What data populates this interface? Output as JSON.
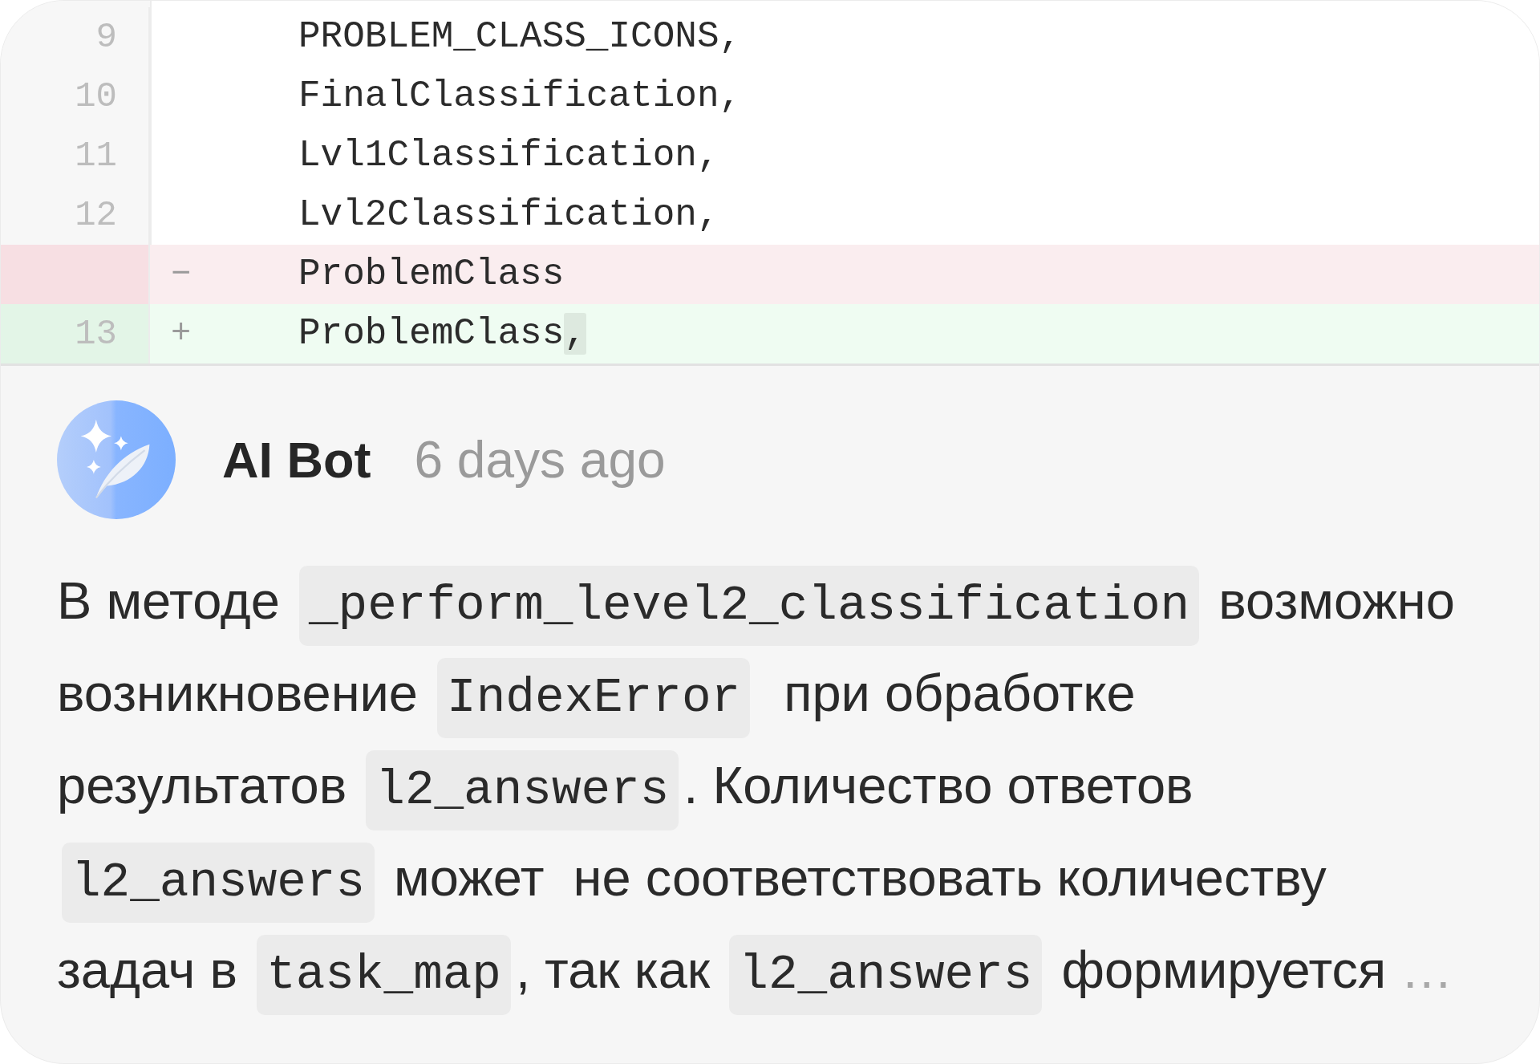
{
  "diff": {
    "lines": [
      {
        "kind": "context",
        "number": "9",
        "segments": [
          {
            "text": "PROBLEM_CLASS_ICONS,",
            "changed": false
          }
        ]
      },
      {
        "kind": "context",
        "number": "10",
        "segments": [
          {
            "text": "FinalClassification,",
            "changed": false
          }
        ]
      },
      {
        "kind": "context",
        "number": "11",
        "segments": [
          {
            "text": "Lvl1Classification,",
            "changed": false
          }
        ]
      },
      {
        "kind": "context",
        "number": "12",
        "segments": [
          {
            "text": "Lvl2Classification,",
            "changed": false
          }
        ]
      },
      {
        "kind": "deleted",
        "sign": "−",
        "segments": [
          {
            "text": "ProblemClass",
            "changed": false
          }
        ]
      },
      {
        "kind": "added",
        "number": "13",
        "sign": "+",
        "segments": [
          {
            "text": "ProblemClass",
            "changed": false
          },
          {
            "text": ",",
            "changed": true
          }
        ]
      }
    ]
  },
  "comment": {
    "author": "AI Bot",
    "time": "6 days ago",
    "body": {
      "lines": [
        [
          {
            "kind": "text",
            "text": "В методе "
          },
          {
            "kind": "code",
            "text": "_perform_level2_classification"
          },
          {
            "kind": "text",
            "text": " возможно"
          }
        ],
        [
          {
            "kind": "text",
            "text": "возникновение "
          },
          {
            "kind": "code",
            "text": "IndexError"
          },
          {
            "kind": "text",
            "text": "  при обработке"
          }
        ],
        [
          {
            "kind": "text",
            "text": "результатов "
          },
          {
            "kind": "code",
            "text": "l2_answers"
          },
          {
            "kind": "text",
            "text": ". Количество ответов"
          }
        ],
        [
          {
            "kind": "code",
            "text": "l2_answers"
          },
          {
            "kind": "text",
            "text": " может  не соответствовать количеству"
          }
        ],
        [
          {
            "kind": "text",
            "text": "задач в "
          },
          {
            "kind": "code",
            "text": "task_map"
          },
          {
            "kind": "text",
            "text": ", так как "
          },
          {
            "kind": "code",
            "text": "l2_answers"
          },
          {
            "kind": "text",
            "text": " формируется "
          },
          {
            "kind": "ellipsis",
            "text": "…"
          }
        ]
      ]
    }
  }
}
